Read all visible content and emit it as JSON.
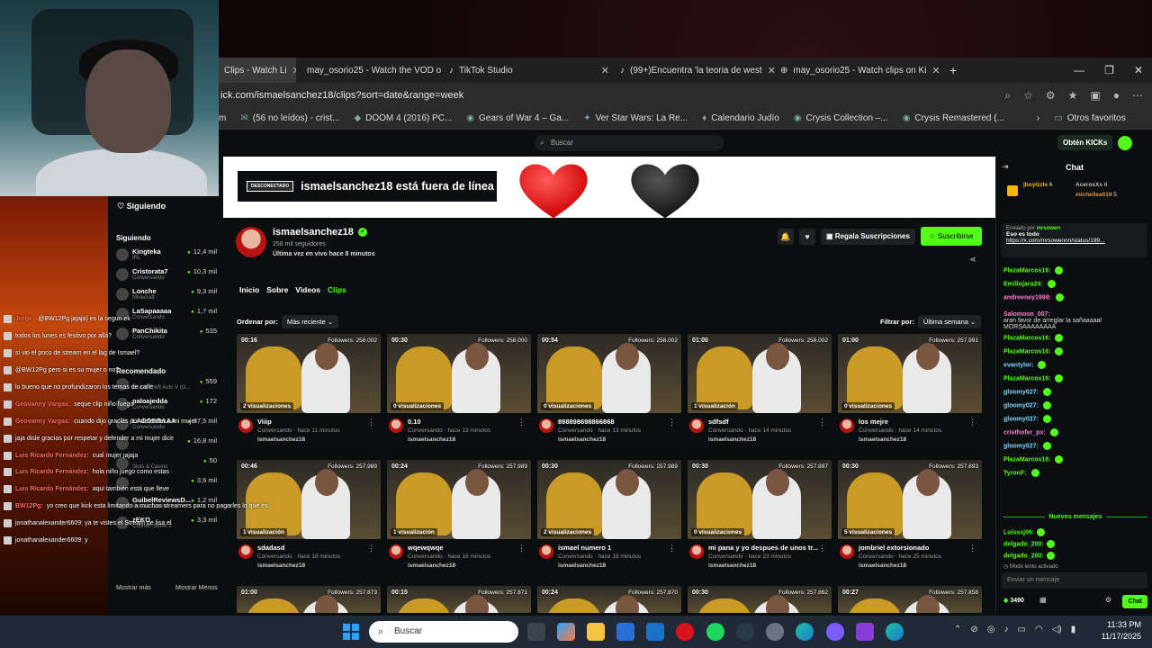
{
  "browser": {
    "tabs": [
      {
        "label": "Clips - Watch Li",
        "active": true
      },
      {
        "label": "may_osorio25 - Watch the VOD o",
        "active": false
      },
      {
        "label": "TikTok Studio",
        "active": false
      },
      {
        "label": "(99+)Encuentra 'la teoria de west",
        "active": false
      },
      {
        "label": "may_osorio25 - Watch clips on Ki",
        "active": false
      }
    ],
    "new_tab": "+",
    "url": "ick.com/ismaelsanchez18/clips?sort=date&range=week",
    "bookmarks": [
      "(56 no leídos) - crist...",
      "DOOM 4 (2016) PC...",
      "Gears of War 4 – Ga...",
      "Ver Star Wars: La Re...",
      "Calendario Judío",
      "Crysis Collection –...",
      "Crysis Remastered (..."
    ],
    "bookmarks_prefix": "m",
    "other_favorites": "Otros favoritos"
  },
  "kick": {
    "search_placeholder": "Buscar",
    "get_kicks": "Obtén KICKs",
    "sidebar": {
      "following_header": "Siguiendo",
      "following_sub": "Siguiendo",
      "channels": [
        {
          "name": "Kingteka",
          "category": "IRL",
          "viewers": "12,4 mil"
        },
        {
          "name": "Cristorata7",
          "category": "Conversando",
          "viewers": "10,3 mil"
        },
        {
          "name": "Lonche",
          "category": "Minecraft",
          "viewers": "9,3 mil"
        },
        {
          "name": "LaSapaaaaa",
          "category": "Conversando",
          "viewers": "1,7 mil"
        },
        {
          "name": "PanChikita",
          "category": "Conversando",
          "viewers": "535"
        },
        {
          "name": "",
          "category": "Grand Theft Auto V (G...",
          "viewers": "559"
        },
        {
          "name": "paloajedda",
          "category": "Conversando",
          "viewers": "172"
        },
        {
          "name": "LACOBRAAA",
          "category": "Conversando",
          "viewers": "37,5 mil"
        },
        {
          "name": "",
          "category": "",
          "viewers": "16,8 mil"
        },
        {
          "name": "",
          "category": "Slots & Casino",
          "viewers": "50"
        },
        {
          "name": "",
          "category": "",
          "viewers": "3,6 mil"
        },
        {
          "name": "GuibelReviewsD...",
          "category": "Slots & Casino",
          "viewers": "1,2 mil"
        },
        {
          "name": "zEKO",
          "category": "Counter-Strike 2",
          "viewers": "3,3 mil"
        }
      ],
      "recommended": "Recomendado",
      "show_more": "Mostrar más",
      "show_less": "Mostrar Menos"
    },
    "banner": {
      "offline_pill": "DESCONECTADO",
      "offline_text": "ismaelsanchez18 está fuera de línea"
    },
    "channel": {
      "name": "ismaelsanchez18",
      "followers": "258 mil seguidores",
      "last_live": "Última vez en vivo hace 8 minutos",
      "gift_subs": "Regala Suscripciones",
      "subscribe": "Suscribirse"
    },
    "nav": [
      "Inicio",
      "Sobre",
      "Videos",
      "Clips"
    ],
    "order_label": "Ordenar por:",
    "order_value": "Más reciente",
    "filter_label": "Filtrar por:",
    "filter_value": "Última semana",
    "clips": [
      {
        "dur": "00:16",
        "followers": "Followers: 258.002",
        "views": "2 visualizaciones",
        "title": "Viiip",
        "meta": "Conversando · hace 11 minutos",
        "owner": "ismaelsanchez18"
      },
      {
        "dur": "00:30",
        "followers": "Followers: 258.000",
        "views": "0 visualizaciones",
        "title": "0.10",
        "meta": "Conversando · hace 13 minutos",
        "owner": "ismaelsanchez18"
      },
      {
        "dur": "00:54",
        "followers": "Followers: 258.002",
        "views": "0 visualizaciones",
        "title": "898898698866868",
        "meta": "Conversando · hace 13 minutos",
        "owner": "ismaelsanchez18"
      },
      {
        "dur": "01:00",
        "followers": "Followers: 258.002",
        "views": "1 visualización",
        "title": "sdfsdf",
        "meta": "Conversando · hace 14 minutos",
        "owner": "ismaelsanchez18"
      },
      {
        "dur": "01:00",
        "followers": "Followers: 257.991",
        "views": "0 visualizaciones",
        "title": "los mejre",
        "meta": "Conversando · hace 14 minutos",
        "owner": "ismaelsanchez18"
      },
      {
        "dur": "00:46",
        "followers": "Followers: 257.989",
        "views": "1 visualización",
        "title": "sdadasd",
        "meta": "Conversando · hace 18 minutos",
        "owner": "ismaelsanchez18"
      },
      {
        "dur": "00:24",
        "followers": "Followers: 257.989",
        "views": "1 visualización",
        "title": "wqewqwqe",
        "meta": "Conversando · hace 16 minutos",
        "owner": "ismaelsanchez18"
      },
      {
        "dur": "00:30",
        "followers": "Followers: 257.989",
        "views": "2 visualizaciones",
        "title": "ismael numero 1",
        "meta": "Conversando · hace 18 minutos",
        "owner": "ismaelsanchez18"
      },
      {
        "dur": "00:30",
        "followers": "Followers: 257.897",
        "views": "0 visualizaciones",
        "title": "mi pana y yo despues de unos tr...",
        "meta": "Conversando · hace 23 minutos",
        "owner": "ismaelsanchez18"
      },
      {
        "dur": "00:30",
        "followers": "Followers: 257.893",
        "views": "5 visualizaciones",
        "title": "jombriel extorsionado",
        "meta": "Conversando · hace 25 minutos",
        "owner": "ismaelsanchez18"
      },
      {
        "dur": "01:00",
        "followers": "Followers: 257.873"
      },
      {
        "dur": "00:15",
        "followers": "Followers: 257.871"
      },
      {
        "dur": "00:24",
        "followers": "Followers: 257.870"
      },
      {
        "dur": "00:30",
        "followers": "Followers: 257.862"
      },
      {
        "dur": "00:27",
        "followers": "Followers: 257.858"
      }
    ],
    "chat": {
      "title": "Chat",
      "gifters": [
        {
          "name": "jboyizzle",
          "count": "6"
        },
        {
          "name": "AceroxXs",
          "count": "6"
        },
        {
          "name": "michellee619",
          "count": "5"
        }
      ],
      "pinned_by": "Enviado por",
      "pinned_user": "mrsowen",
      "pinned_text": "Eso es todo",
      "pinned_link": "https://x.com/mrsowennn/status/199...",
      "messages": [
        {
          "user": "PlazaMarcos16:",
          "text": ""
        },
        {
          "user": "Emiliojara24:",
          "text": ""
        },
        {
          "user": "andreeney1999:",
          "text": ""
        },
        {
          "user": "Salomoon_007:",
          "text": "aran favor de arreglar la sañaaaaal MORSAAAAAAAA"
        },
        {
          "user": "PlazaMarcos16:",
          "text": ""
        },
        {
          "user": "PlazaMarcos16:",
          "text": ""
        },
        {
          "user": "evantylor:",
          "text": ""
        },
        {
          "user": "PlazaMarcos16:",
          "text": ""
        },
        {
          "user": "gloomy027:",
          "text": ""
        },
        {
          "user": "gloomy027:",
          "text": ""
        },
        {
          "user": "gloomy027:",
          "text": ""
        },
        {
          "user": "cristhofer_px:",
          "text": ""
        },
        {
          "user": "gloomy027:",
          "text": ""
        },
        {
          "user": "PlazaMarcos16:",
          "text": ""
        },
        {
          "user": "TyronF:",
          "text": ""
        }
      ],
      "new_messages": "Nuevos mensajes",
      "after_messages": [
        {
          "user": "Luisssj06:",
          "text": ""
        },
        {
          "user": "delgado_200:",
          "text": ""
        },
        {
          "user": "delgado_200:",
          "text": ""
        }
      ],
      "slow_mode": "Modo lento activado",
      "input_placeholder": "Enviar un mensaje",
      "points": "3490",
      "send": "Chat"
    }
  },
  "stream_overlay": [
    {
      "user": "Jorge:",
      "text": "@BW12Pg jajaja) es la segun ek"
    },
    {
      "user": "",
      "text": "todos los lunes es festivo por allá?"
    },
    {
      "user": "",
      "text": "si vio el poco de stream en el lag de Ismael?"
    },
    {
      "user": "",
      "text": "@BW12Pg pero si es su mujer o no?"
    },
    {
      "user": "",
      "text": "lo bueno que no profundizaron los temas de calle"
    },
    {
      "user": "Geovanny Vargas:",
      "text": "seque clip niño fuego"
    },
    {
      "user": "Geovanny Vargas:",
      "text": "cuando dijo gracias por defender a mi mujer"
    },
    {
      "user": "",
      "text": "jaja disle gracias por respetar y defender a mi mujer dice"
    },
    {
      "user": "Luis Ricardo Fernández:",
      "text": "cual mujer jajaja"
    },
    {
      "user": "Luis Ricardo Fernández:",
      "text": "hola niño juego como estas"
    },
    {
      "user": "Luis Ricardo Fernández:",
      "text": "aqui también está que lleve"
    },
    {
      "user": "BW12Pg:",
      "text": "yo creo que kick esta limitando a muchos streamers para no pagarles lo que es"
    },
    {
      "user": "",
      "text": "jonathanalexander6609: ya te vistes el Stream de lisa el"
    },
    {
      "user": "",
      "text": "jonathanalexander6609: y"
    }
  ],
  "taskbar": {
    "search": "Buscar",
    "time": "11:33 PM",
    "date": "11/17/2025"
  }
}
